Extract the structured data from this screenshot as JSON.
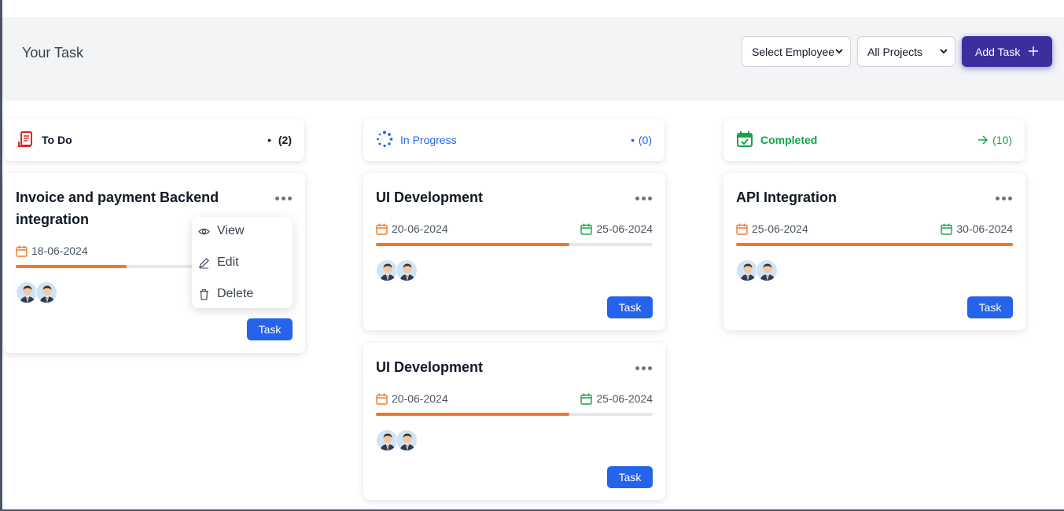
{
  "header": {
    "title": "Your Task",
    "employee_select": "Select Employee",
    "project_select": "All Projects",
    "add_button": "Add Task"
  },
  "columns": [
    {
      "label": "To Do",
      "count": "(2)",
      "marker": "•",
      "icon": "receipt-icon",
      "color": "#dc2626"
    },
    {
      "label": "In Progress",
      "count": "(0)",
      "marker": "•",
      "icon": "spinner-icon",
      "color": "#2563eb"
    },
    {
      "label": "Completed",
      "count": "(10)",
      "marker": "→",
      "icon": "calendar-check-icon",
      "color": "#16a34a"
    }
  ],
  "cards": [
    {
      "title_line1": "Invoice and payment Backend",
      "title_line2": "integration",
      "start_date": "18-06-2024",
      "progress": 0.4,
      "button": "Task"
    },
    {
      "title": "UI Development",
      "start_date": "20-06-2024",
      "end_date": "25-06-2024",
      "progress": 0.7,
      "button": "Task"
    },
    {
      "title": "UI Development",
      "start_date": "20-06-2024",
      "end_date": "25-06-2024",
      "progress": 0.7,
      "button": "Task"
    },
    {
      "title": "API Integration",
      "start_date": "25-06-2024",
      "end_date": "30-06-2024",
      "progress": 1.0,
      "button": "Task"
    }
  ],
  "context_menu": {
    "view": "View",
    "edit": "Edit",
    "delete": "Delete"
  },
  "colors": {
    "accent": "#3b2fa0",
    "task_button": "#2563eb",
    "progress": "#f0782a",
    "start_date": "#f0782a",
    "end_date": "#16a34a"
  }
}
